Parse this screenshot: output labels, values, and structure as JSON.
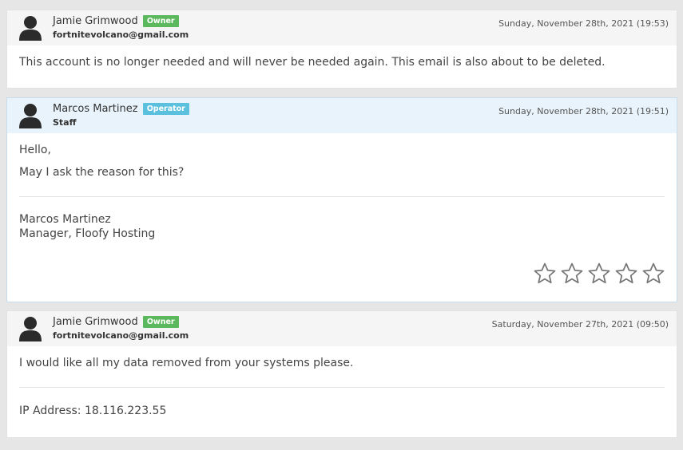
{
  "messages": [
    {
      "author": "Jamie Grimwood",
      "role_badge": "Owner",
      "badge_color": "#5cb85c",
      "subline": "fortnitevolcano@gmail.com",
      "date": "Sunday, November 28th, 2021 (19:53)",
      "body": [
        "This account is no longer needed and will never be needed again. This email is also about to be deleted."
      ]
    },
    {
      "author": "Marcos Martinez",
      "role_badge": "Operator",
      "badge_color": "#5bc0de",
      "subline": "Staff",
      "date": "Sunday, November 28th, 2021 (19:51)",
      "body": [
        "Hello,",
        "May I ask the reason for this?"
      ],
      "signature": [
        "Marcos Martinez",
        "Manager, Floofy Hosting"
      ],
      "rating": {
        "max": 5,
        "value": 0
      }
    },
    {
      "author": "Jamie Grimwood",
      "role_badge": "Owner",
      "badge_color": "#5cb85c",
      "subline": "fortnitevolcano@gmail.com",
      "date": "Saturday, November 27th, 2021 (09:50)",
      "body": [
        "I would like all my data removed from your systems please."
      ],
      "ip_line": "IP Address: 18.116.223.55"
    }
  ],
  "icons": {
    "avatar": "user-avatar-icon",
    "star": "star-outline-icon"
  }
}
